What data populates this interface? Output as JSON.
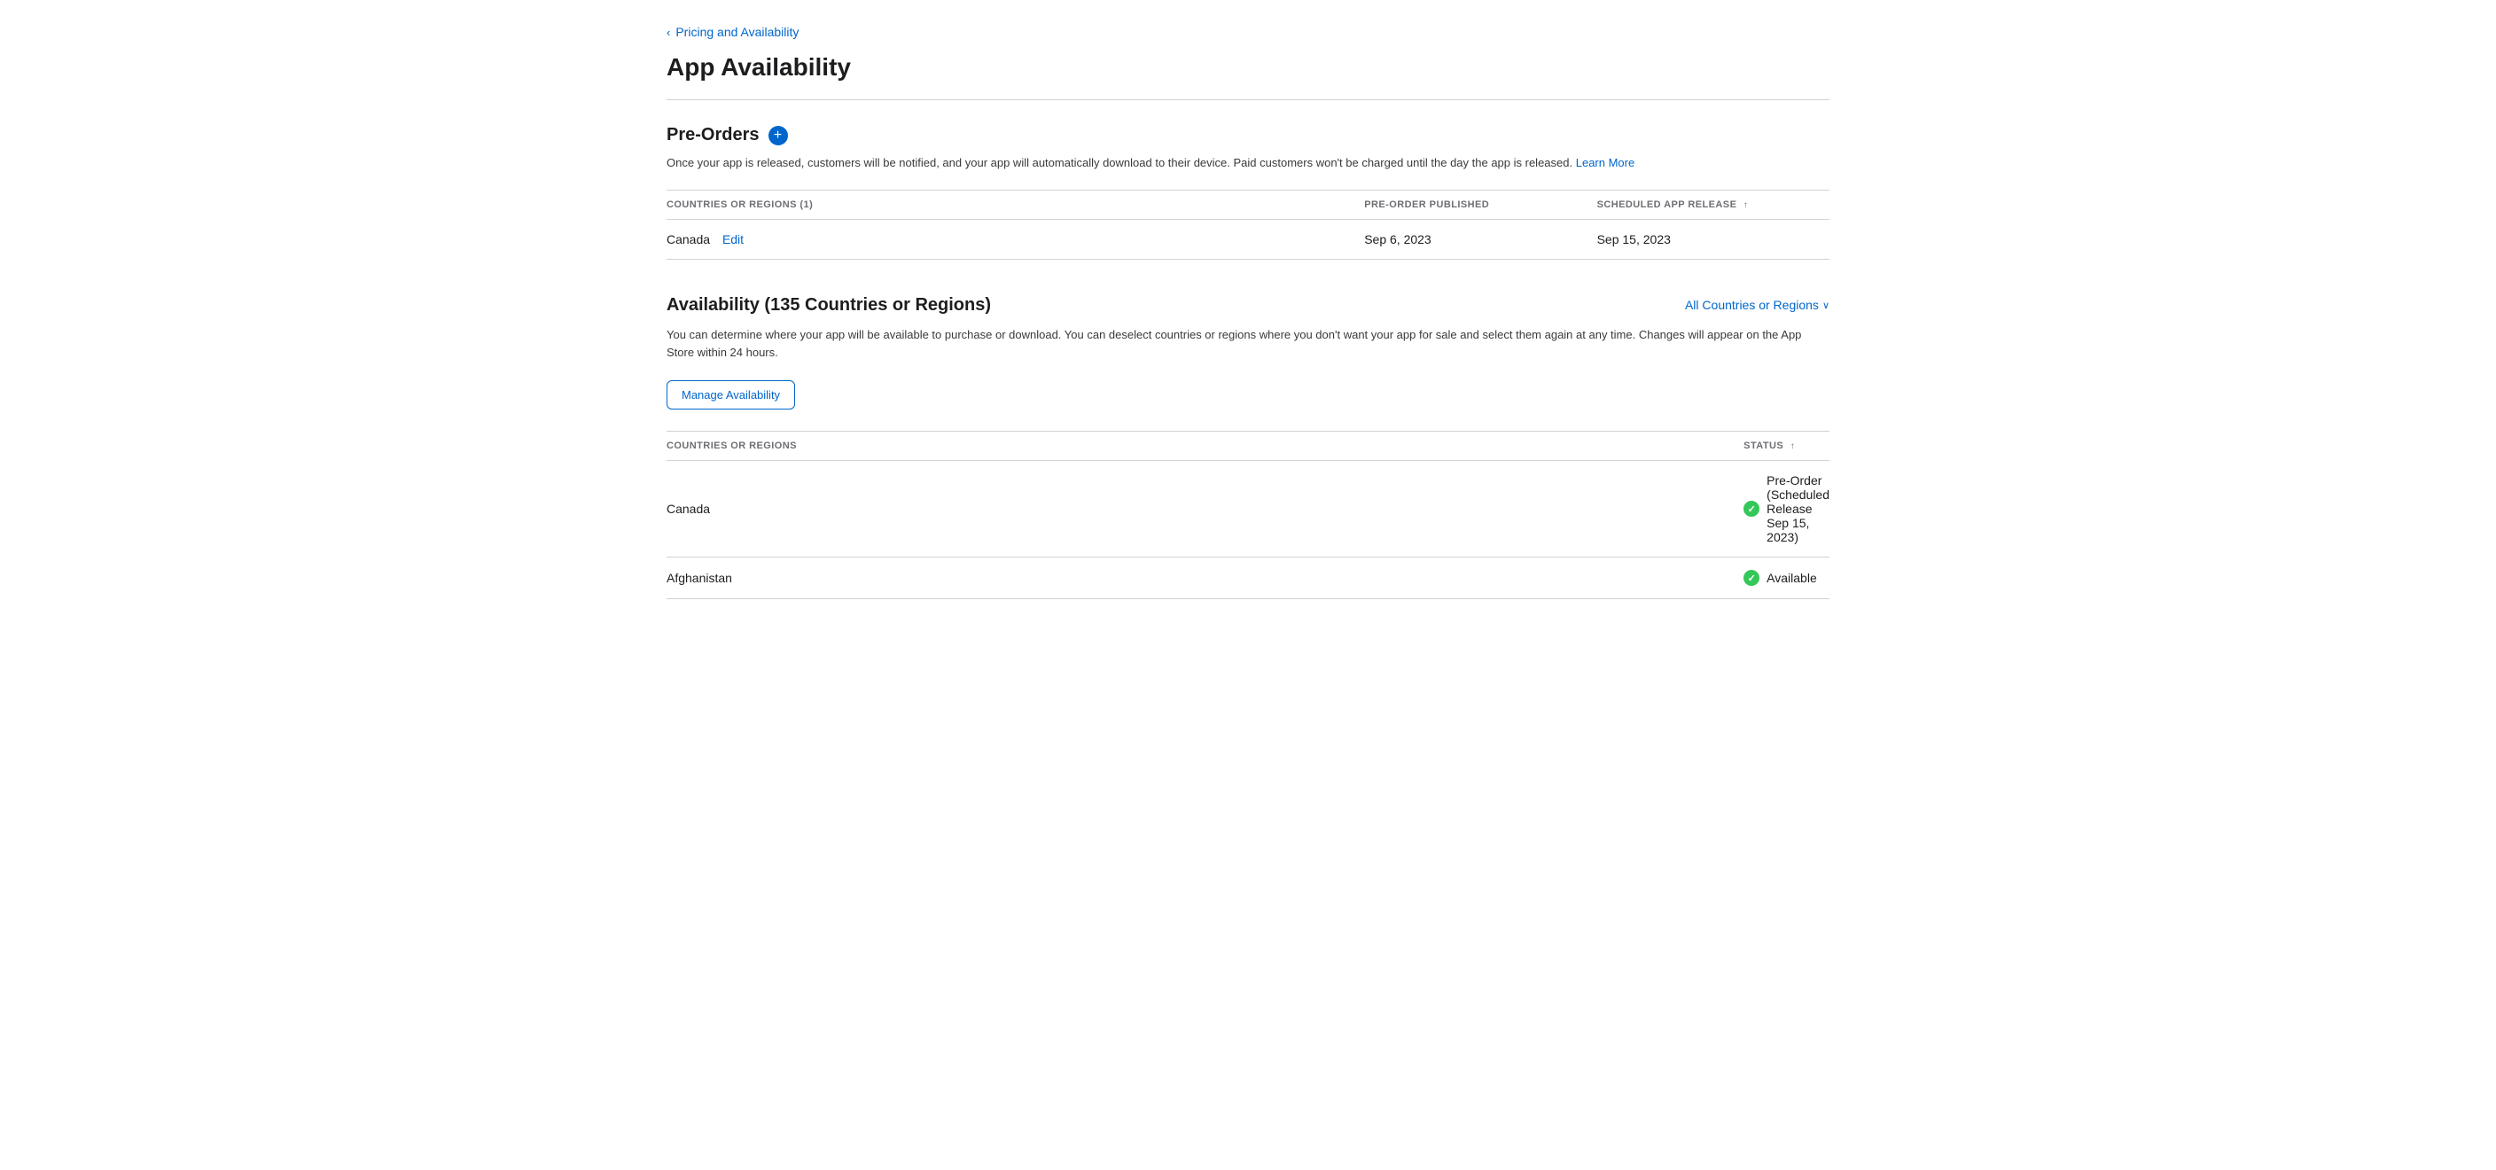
{
  "breadcrumb": {
    "chevron": "‹",
    "label": "Pricing and Availability"
  },
  "page": {
    "title": "App Availability"
  },
  "preorders": {
    "section_title": "Pre-Orders",
    "description": "Once your app is released, customers will be notified, and your app will automatically download to their device. Paid customers won't be charged until the day the app is released.",
    "learn_more_label": "Learn More",
    "table": {
      "col_countries": "COUNTRIES OR REGIONS (1)",
      "col_preorder": "PRE-ORDER PUBLISHED",
      "col_scheduled": "SCHEDULED APP RELEASE",
      "sort_indicator": "↑",
      "rows": [
        {
          "country": "Canada",
          "edit_label": "Edit",
          "preorder_date": "Sep 6, 2023",
          "scheduled_date": "Sep 15, 2023"
        }
      ]
    }
  },
  "availability": {
    "section_title": "Availability (135 Countries or Regions)",
    "all_countries_label": "All Countries or Regions",
    "description": "You can determine where your app will be available to purchase or download. You can deselect countries or regions where you don't want your app for sale and select them again at any time. Changes will appear on the App Store within 24 hours.",
    "manage_button_label": "Manage Availability",
    "table": {
      "col_countries": "COUNTRIES OR REGIONS",
      "col_status": "STATUS",
      "sort_indicator": "↑",
      "rows": [
        {
          "country": "Canada",
          "status": "Pre-Order (Scheduled Release Sep 15, 2023)"
        },
        {
          "country": "Afghanistan",
          "status": "Available"
        }
      ]
    }
  }
}
